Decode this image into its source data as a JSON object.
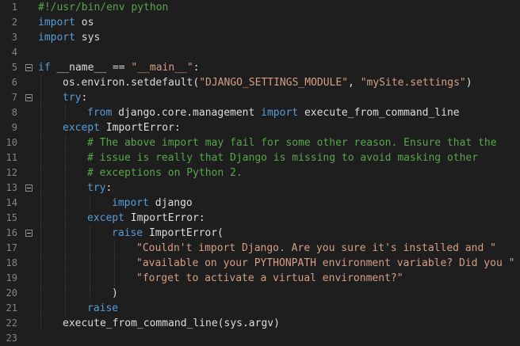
{
  "colors": {
    "background": "#1e1e1e",
    "line_number": "#858585",
    "keyword": "#569cd6",
    "string": "#d69d85",
    "comment": "#57a64a",
    "text": "#dcdcdc"
  },
  "lines": [
    {
      "num": "1",
      "fold": false,
      "indent": 0,
      "segments": [
        {
          "t": "#!/usr/bin/env python",
          "c": "cm"
        }
      ]
    },
    {
      "num": "2",
      "fold": false,
      "indent": 0,
      "segments": [
        {
          "t": "import",
          "c": "kw"
        },
        {
          "t": " os",
          "c": "tx"
        }
      ]
    },
    {
      "num": "3",
      "fold": false,
      "indent": 0,
      "segments": [
        {
          "t": "import",
          "c": "kw"
        },
        {
          "t": " sys",
          "c": "tx"
        }
      ]
    },
    {
      "num": "4",
      "fold": false,
      "indent": 0,
      "segments": []
    },
    {
      "num": "5",
      "fold": true,
      "indent": 0,
      "segments": [
        {
          "t": "if",
          "c": "kw"
        },
        {
          "t": " __name__ == ",
          "c": "tx"
        },
        {
          "t": "\"__main__\"",
          "c": "str"
        },
        {
          "t": ":",
          "c": "tx"
        }
      ]
    },
    {
      "num": "6",
      "fold": false,
      "indent": 1,
      "segments": [
        {
          "t": "os.environ.setdefault(",
          "c": "tx"
        },
        {
          "t": "\"DJANGO_SETTINGS_MODULE\"",
          "c": "str"
        },
        {
          "t": ", ",
          "c": "tx"
        },
        {
          "t": "\"mySite.settings\"",
          "c": "str"
        },
        {
          "t": ")",
          "c": "tx"
        }
      ]
    },
    {
      "num": "7",
      "fold": true,
      "indent": 1,
      "segments": [
        {
          "t": "try",
          "c": "kw"
        },
        {
          "t": ":",
          "c": "tx"
        }
      ]
    },
    {
      "num": "8",
      "fold": false,
      "indent": 2,
      "segments": [
        {
          "t": "from",
          "c": "kw"
        },
        {
          "t": " django.core.management ",
          "c": "tx"
        },
        {
          "t": "import",
          "c": "kw"
        },
        {
          "t": " execute_from_command_line",
          "c": "tx"
        }
      ]
    },
    {
      "num": "9",
      "fold": false,
      "indent": 1,
      "segments": [
        {
          "t": "except",
          "c": "kw"
        },
        {
          "t": " ImportError:",
          "c": "tx"
        }
      ]
    },
    {
      "num": "10",
      "fold": false,
      "indent": 2,
      "segments": [
        {
          "t": "# The above import may fail for some other reason. Ensure that the",
          "c": "cm"
        }
      ]
    },
    {
      "num": "11",
      "fold": false,
      "indent": 2,
      "segments": [
        {
          "t": "# issue is really that Django is missing to avoid masking other",
          "c": "cm"
        }
      ]
    },
    {
      "num": "12",
      "fold": false,
      "indent": 2,
      "segments": [
        {
          "t": "# exceptions on Python 2.",
          "c": "cm"
        }
      ]
    },
    {
      "num": "13",
      "fold": true,
      "indent": 2,
      "segments": [
        {
          "t": "try",
          "c": "kw"
        },
        {
          "t": ":",
          "c": "tx"
        }
      ]
    },
    {
      "num": "14",
      "fold": false,
      "indent": 3,
      "segments": [
        {
          "t": "import",
          "c": "kw"
        },
        {
          "t": " django",
          "c": "tx"
        }
      ]
    },
    {
      "num": "15",
      "fold": false,
      "indent": 2,
      "segments": [
        {
          "t": "except",
          "c": "kw"
        },
        {
          "t": " ImportError:",
          "c": "tx"
        }
      ]
    },
    {
      "num": "16",
      "fold": true,
      "indent": 3,
      "segments": [
        {
          "t": "raise",
          "c": "kw"
        },
        {
          "t": " ImportError(",
          "c": "tx"
        }
      ]
    },
    {
      "num": "17",
      "fold": false,
      "indent": 4,
      "segments": [
        {
          "t": "\"Couldn't import Django. Are you sure it's installed and \"",
          "c": "str"
        }
      ]
    },
    {
      "num": "18",
      "fold": false,
      "indent": 4,
      "segments": [
        {
          "t": "\"available on your PYTHONPATH environment variable? Did you \"",
          "c": "str"
        }
      ]
    },
    {
      "num": "19",
      "fold": false,
      "indent": 4,
      "segments": [
        {
          "t": "\"forget to activate a virtual environment?\"",
          "c": "str"
        }
      ]
    },
    {
      "num": "20",
      "fold": false,
      "indent": 3,
      "segments": [
        {
          "t": ")",
          "c": "tx"
        }
      ]
    },
    {
      "num": "21",
      "fold": false,
      "indent": 2,
      "segments": [
        {
          "t": "raise",
          "c": "kw"
        }
      ]
    },
    {
      "num": "22",
      "fold": false,
      "indent": 1,
      "segments": [
        {
          "t": "execute_from_command_line(sys.argv)",
          "c": "tx"
        }
      ]
    },
    {
      "num": "23",
      "fold": false,
      "indent": 0,
      "segments": []
    }
  ]
}
